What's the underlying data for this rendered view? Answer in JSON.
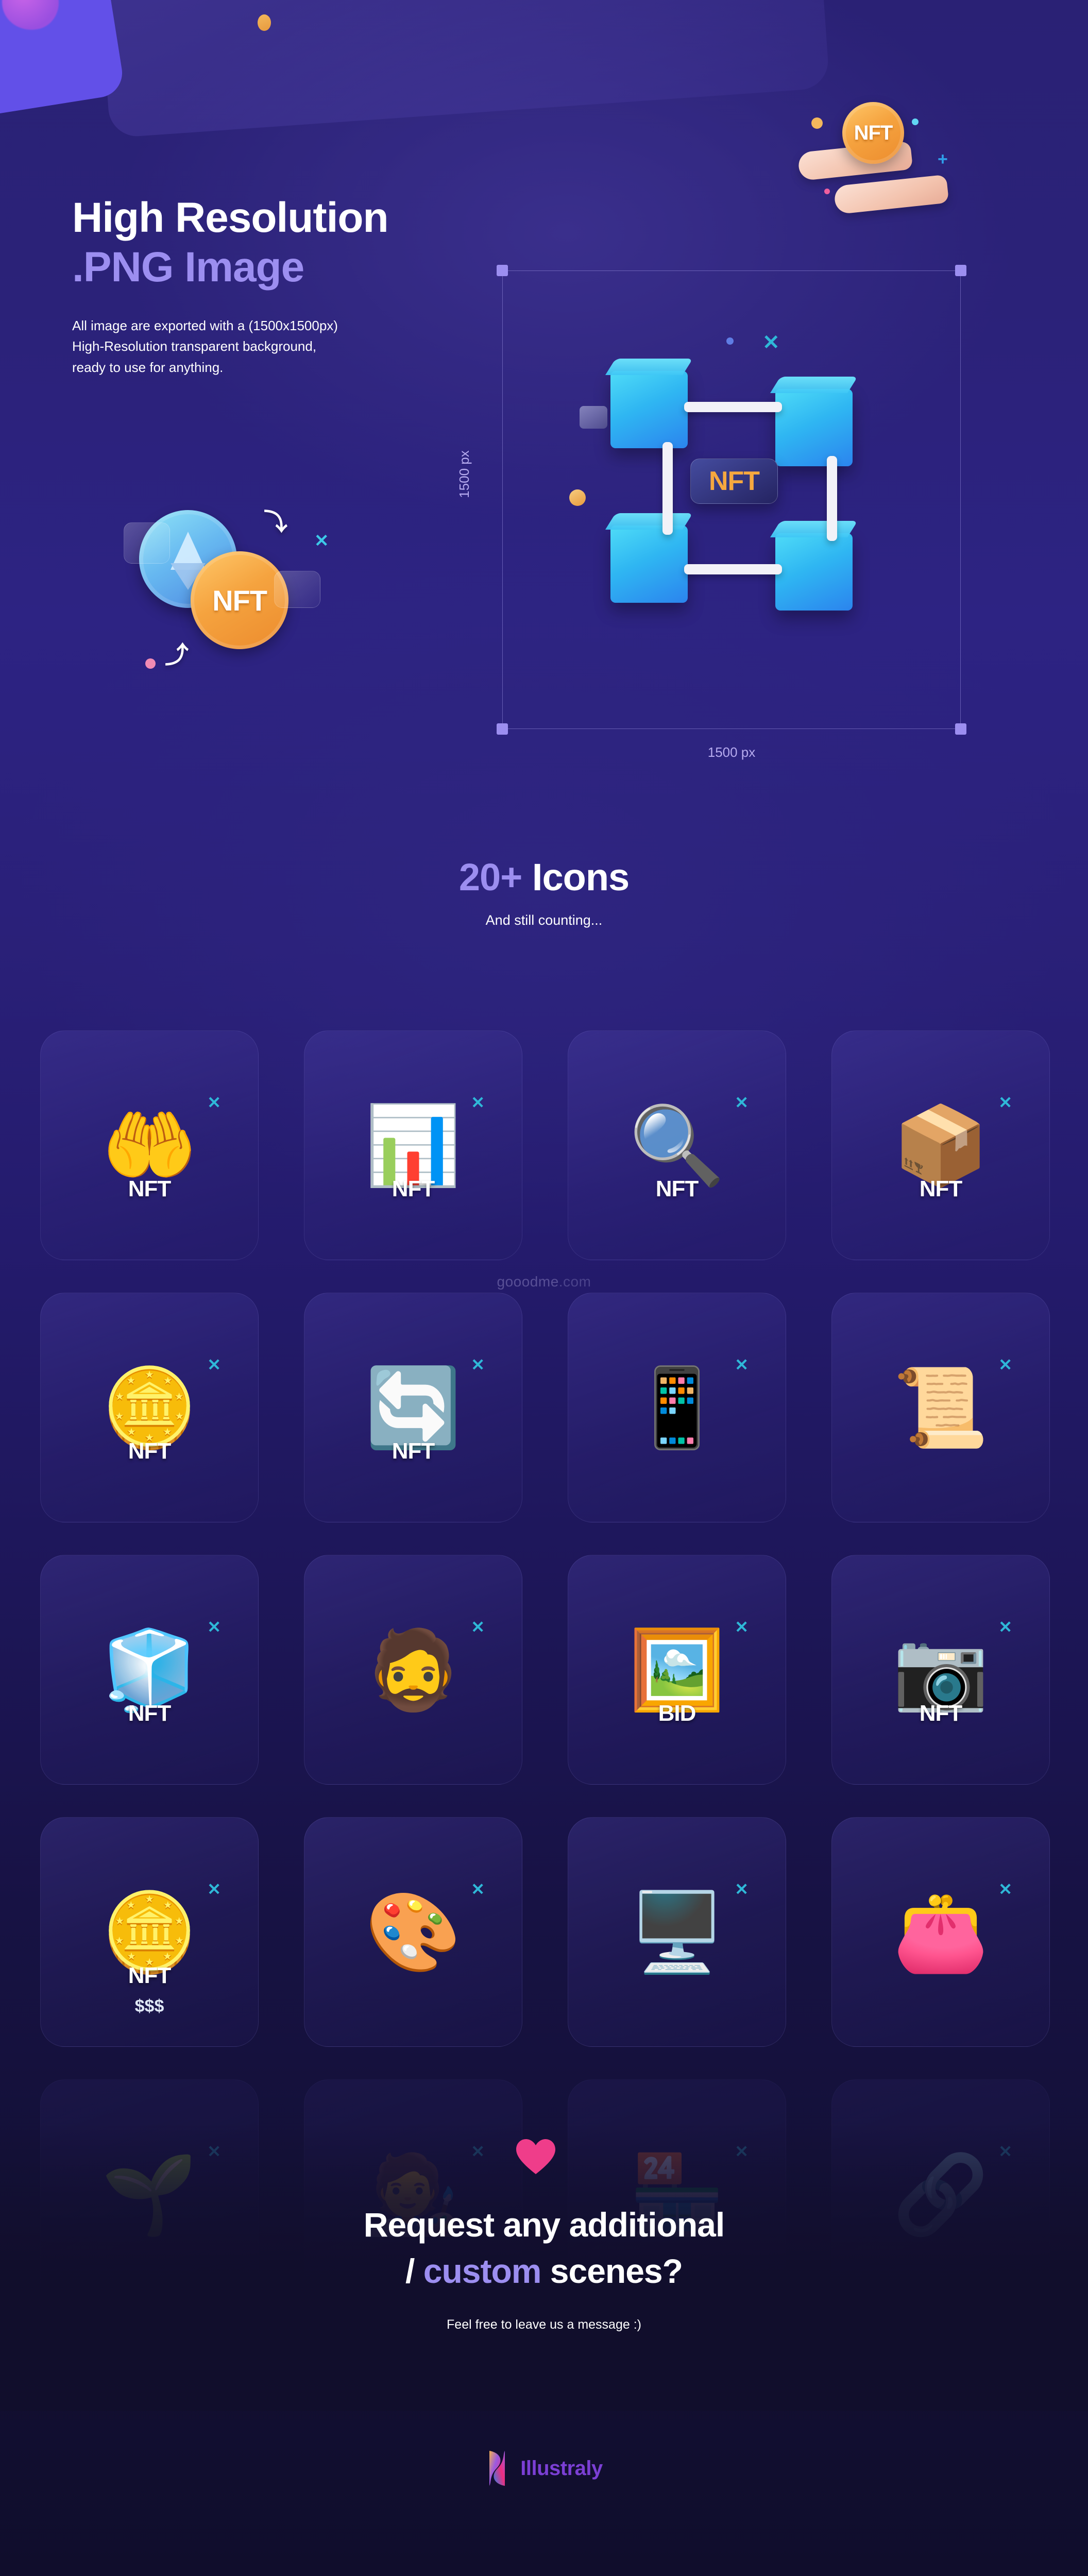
{
  "hero": {
    "title_line1": "High Resolution",
    "title_line2": ".PNG Image",
    "description": "All image are exported with a (1500x1500px)\nHigh-Resolution transparent background,\nready to use for anything.",
    "coin_label": "NFT",
    "exchange": {
      "nft_label": "NFT",
      "eth_icon": "ethereum-coin-icon",
      "swap_up_icon": "arrow-swap-up-icon",
      "swap_down_icon": "arrow-swap-down-icon",
      "x_icon": "x-sparkle-icon"
    },
    "decor": {
      "left_card_icon": "purple-rounded-card",
      "top_panel_icon": "tilted-panel",
      "gold_dot_icon": "gold-dot-icon"
    }
  },
  "preview": {
    "width_label": "1500 px",
    "height_label": "1500 px",
    "badge_label": "NFT",
    "handles": [
      "top-left",
      "top-right",
      "bottom-left",
      "bottom-right"
    ],
    "scene_name": "blockchain-nodes-scene"
  },
  "icons_section": {
    "count_label": "20+",
    "heading_rest": "Icons",
    "subheading": "And still counting...",
    "cards": [
      {
        "name": "nft-coin-in-hands-card",
        "glyph": "🤲",
        "label": "NFT",
        "row": 1
      },
      {
        "name": "nft-growth-chart-card",
        "glyph": "📊",
        "label": "NFT",
        "row": 1
      },
      {
        "name": "nft-search-magnifier-card",
        "glyph": "🔍",
        "label": "NFT",
        "row": 1
      },
      {
        "name": "nft-coin-in-box-card",
        "glyph": "📦",
        "label": "NFT",
        "row": 1
      },
      {
        "name": "nft-network-coin-card",
        "glyph": "🪙",
        "label": "NFT",
        "row": 2
      },
      {
        "name": "nft-eth-swap-card",
        "glyph": "🔄",
        "label": "NFT",
        "row": 2
      },
      {
        "name": "nft-mobile-app-card",
        "glyph": "📱",
        "label": "",
        "row": 2
      },
      {
        "name": "nft-certificate-card",
        "glyph": "📜",
        "label": "",
        "row": 2
      },
      {
        "name": "nft-blockchain-cubes-card",
        "glyph": "🧊",
        "label": "NFT",
        "row": 3
      },
      {
        "name": "nft-collector-avatar-card",
        "glyph": "🧔",
        "label": "",
        "row": 3
      },
      {
        "name": "nft-bid-artwork-card",
        "glyph": "🖼️",
        "label": "BID",
        "row": 3
      },
      {
        "name": "nft-photo-file-card",
        "glyph": "📷",
        "label": "NFT",
        "row": 3
      },
      {
        "name": "nft-coin-price-card",
        "glyph": "🪙",
        "label": "NFT",
        "sublabel": "$$$",
        "row": 4
      },
      {
        "name": "nft-art-palette-card",
        "glyph": "🎨",
        "label": "",
        "row": 4
      },
      {
        "name": "nft-desktop-listing-card",
        "glyph": "🖥️",
        "label": "",
        "row": 4
      },
      {
        "name": "nft-wallet-card",
        "glyph": "👛",
        "label": "",
        "row": 4
      },
      {
        "name": "nft-growth-plant-card",
        "glyph": "🌱",
        "label": "",
        "row": 5
      },
      {
        "name": "nft-profile-artwork-card",
        "glyph": "🧑‍🎨",
        "label": "",
        "row": 5
      },
      {
        "name": "nft-marketplace-shop-card",
        "glyph": "🏪",
        "label": "",
        "row": 5
      },
      {
        "name": "nft-network-share-card",
        "glyph": "🔗",
        "label": "",
        "row": 5
      }
    ]
  },
  "watermark": {
    "name": "gooodme",
    "tld": ".com"
  },
  "cta": {
    "line1": "Request any additional",
    "slash": "/ ",
    "custom": "custom",
    "rest": " scenes?",
    "subtitle": "Feel free to leave us a message :)",
    "heart_icon": "heart-icon"
  },
  "footer": {
    "logo_text": "Illustraly",
    "logo_mark": "illustraly-mark-icon"
  },
  "colors": {
    "accent_purple": "#9c8ef0",
    "brand_purple": "#7b3fd4",
    "coin_orange": "#f5a33f",
    "cube_blue": "#2fb6f2",
    "heart_pink": "#ef3d8a",
    "bg_deep": "#14113f"
  }
}
